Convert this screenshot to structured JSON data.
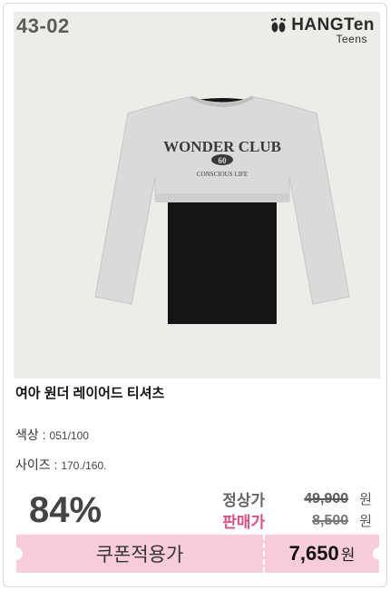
{
  "product": {
    "sku": "43-02",
    "brand_name": "HANGTen",
    "brand_sub": "Teens",
    "title": "여아 원더 레이어드 티셔츠",
    "print_line1": "WONDER CLUB",
    "print_number": "60",
    "print_line2": "CONSCIOUS LIFE"
  },
  "attributes": {
    "color_label": "색상 :",
    "color_value": "051/100",
    "size_label": "사이즈 :",
    "size_value": "170./160."
  },
  "pricing": {
    "discount": "84%",
    "regular_label": "정상가",
    "regular_price": "49,900",
    "sale_label": "판매가",
    "sale_price": "8,500",
    "currency": "원",
    "coupon_label": "쿠폰적용가",
    "coupon_price": "7,650"
  },
  "colors": {
    "accent_pink": "#f8ccdc",
    "sale_label_pink": "#d94f86",
    "image_bg": "#ecece8"
  }
}
